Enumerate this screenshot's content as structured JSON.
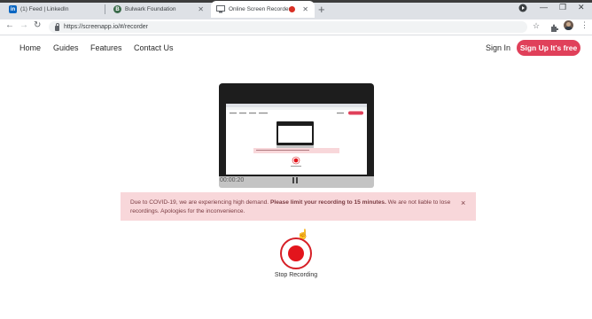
{
  "browser": {
    "tabs": [
      {
        "title": "(1) Feed | LinkedIn",
        "favicon": "in",
        "favicon_color": "#0a66c2"
      },
      {
        "title": "Bulwark Foundation",
        "favicon": "B",
        "favicon_color": "#3b6b4b"
      },
      {
        "title": "Online Screen Recorder",
        "favicon": "",
        "favicon_color": "#5f6368"
      }
    ],
    "url": "https://screenapp.io/#/recorder"
  },
  "site_nav": {
    "links": [
      "Home",
      "Guides",
      "Features",
      "Contact Us"
    ],
    "signin": "Sign In",
    "signup": "Sign Up It's free"
  },
  "preview": {
    "timecode": "00:00:20"
  },
  "alert": {
    "text_before": "Due to COVID-19, we are experiencing high demand. ",
    "text_bold": "Please limit your recording to 15 minutes.",
    "text_after": " We are not liable to lose recordings. Apologies for the inconvenience."
  },
  "recorder": {
    "stop_label": "Stop Recording"
  },
  "colors": {
    "accent": "#e0405a",
    "record_red": "#e3151c",
    "alert_bg": "#f8d7da"
  }
}
